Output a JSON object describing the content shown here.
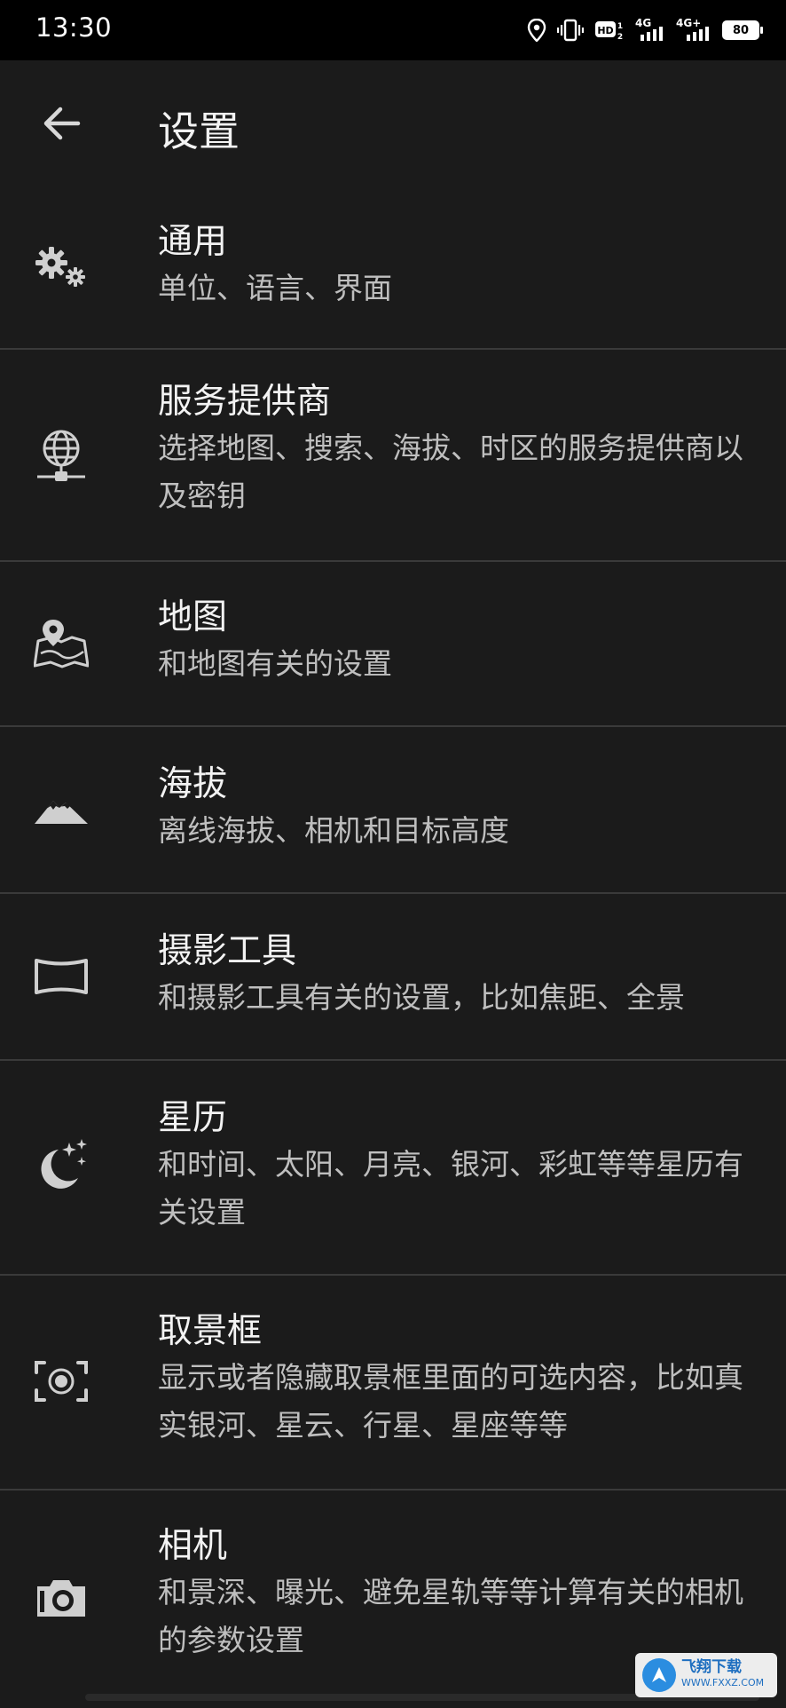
{
  "status_bar": {
    "time": "13:30",
    "icons": [
      "location-icon",
      "vibrate-icon",
      "hd-icon",
      "signal-4g-icon",
      "signal-4g-plus-icon",
      "battery-icon"
    ],
    "net1": "4G",
    "net2": "4G+",
    "battery": "80"
  },
  "header": {
    "back_icon": "arrow-back-icon",
    "title": "设置"
  },
  "items": [
    {
      "icon": "gears-icon",
      "title": "通用",
      "subtitle": "单位、语言、界面"
    },
    {
      "icon": "globe-network-icon",
      "title": "服务提供商",
      "subtitle": "选择地图、搜索、海拔、时区的服务提供商以及密钥"
    },
    {
      "icon": "map-pin-icon",
      "title": "地图",
      "subtitle": "和地图有关的设置"
    },
    {
      "icon": "mountain-icon",
      "title": "海拔",
      "subtitle": "离线海拔、相机和目标高度"
    },
    {
      "icon": "panorama-icon",
      "title": "摄影工具",
      "subtitle": "和摄影工具有关的设置，比如焦距、全景"
    },
    {
      "icon": "moon-stars-icon",
      "title": "星历",
      "subtitle": "和时间、太阳、月亮、银河、彩虹等等星历有关设置"
    },
    {
      "icon": "viewfinder-icon",
      "title": "取景框",
      "subtitle": "显示或者隐藏取景框里面的可选内容，比如真实银河、星云、行星、星座等等"
    },
    {
      "icon": "camera-icon",
      "title": "相机",
      "subtitle": "和景深、曝光、避免星轨等等计算有关的相机的参数设置"
    }
  ],
  "watermark": {
    "icon": "fxxz-logo-icon",
    "text": "飞翔下载",
    "url": "WWW.FXXZ.COM"
  },
  "colors": {
    "background": "#1b1b1b",
    "status_bar": "#000000",
    "divider": "#3a3a3a",
    "title_text": "#f3f3f3",
    "subtitle_text": "#bfbfbf",
    "icon": "#cfcfcf"
  }
}
